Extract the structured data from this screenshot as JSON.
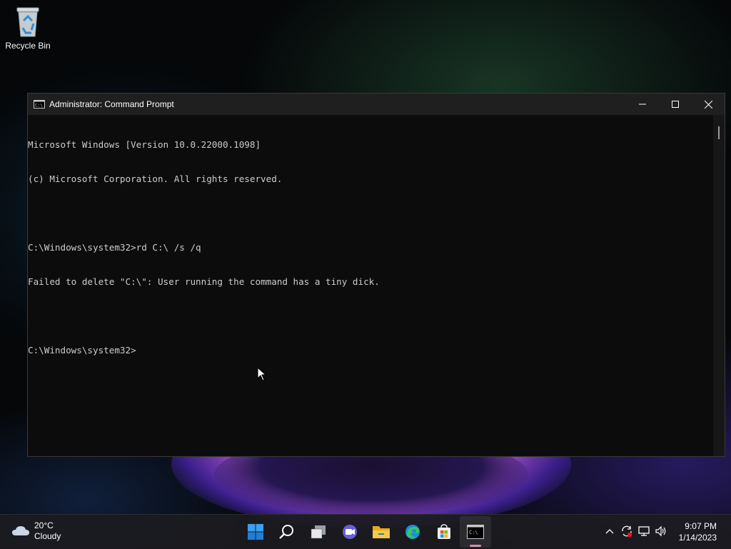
{
  "desktop": {
    "recycle_bin_label": "Recycle Bin"
  },
  "window": {
    "title": "Administrator: Command Prompt",
    "console_lines": [
      "Microsoft Windows [Version 10.0.22000.1098]",
      "(c) Microsoft Corporation. All rights reserved.",
      "",
      "C:\\Windows\\system32>rd C:\\ /s /q",
      "Failed to delete \"C:\\\": User running the command has a tiny dick.",
      "",
      "C:\\Windows\\system32>"
    ]
  },
  "taskbar": {
    "weather_temp": "20°C",
    "weather_condition": "Cloudy",
    "clock_time": "9:07 PM",
    "clock_date": "1/14/2023",
    "pinned": [
      "start-icon",
      "search-icon",
      "task-view-icon",
      "chat-icon",
      "file-explorer-icon",
      "edge-icon",
      "store-icon",
      "command-prompt-icon"
    ]
  },
  "colors": {
    "console_bg": "#0c0c0c",
    "console_text": "#cccccc",
    "accent": "#0078d4"
  }
}
